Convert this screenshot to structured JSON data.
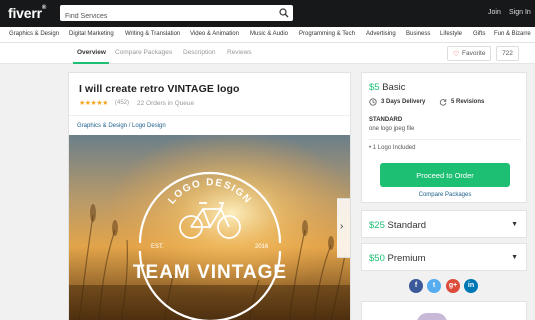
{
  "header": {
    "logo": "fiverr",
    "logo_mark": "®",
    "search_placeholder": "Find Services",
    "join": "Join",
    "signin": "Sign In"
  },
  "categories": [
    "Graphics & Design",
    "Digital Marketing",
    "Writing & Translation",
    "Video & Animation",
    "Music & Audio",
    "Programming & Tech",
    "Advertising",
    "Business",
    "Lifestyle",
    "Gifts",
    "Fun & Bizarre"
  ],
  "subnav": {
    "tabs": [
      "Overview",
      "Compare Packages",
      "Description",
      "Reviews"
    ],
    "favorite": "Favorite",
    "favorite_count": "722"
  },
  "gig": {
    "title": "I will create retro VINTAGE logo",
    "stars": "★★★★★",
    "rating_count": "(452)",
    "orders": "22 Orders in Queue",
    "breadcrumb": "Graphics & Design / Logo Design",
    "image": {
      "arc_text": "LOGO DESIGN",
      "est": "EST.",
      "year": "2016",
      "brand": "TEAM VINTAGE"
    }
  },
  "packages": {
    "basic": {
      "price": "$5",
      "name": "Basic",
      "delivery": "3 Days Delivery",
      "revisions": "5 Revisions",
      "tier": "STANDARD",
      "description": "one logo jpeg file",
      "included": "• 1 Logo Included",
      "cta": "Proceed to Order",
      "compare": "Compare Packages"
    },
    "standard": {
      "price": "$25",
      "name": "Standard"
    },
    "premium": {
      "price": "$50",
      "name": "Premium"
    }
  },
  "social": [
    {
      "icon": "facebook-icon",
      "glyph": "f",
      "color": "#3b5998"
    },
    {
      "icon": "twitter-icon",
      "glyph": "t",
      "color": "#55acee"
    },
    {
      "icon": "google-plus-icon",
      "glyph": "g+",
      "color": "#dd4b39"
    },
    {
      "icon": "linkedin-icon",
      "glyph": "in",
      "color": "#0077b5"
    }
  ],
  "colors": {
    "accent": "#1dbf73",
    "link": "#1b5e8c",
    "topbar": "#16181a",
    "star": "#f5a623"
  }
}
